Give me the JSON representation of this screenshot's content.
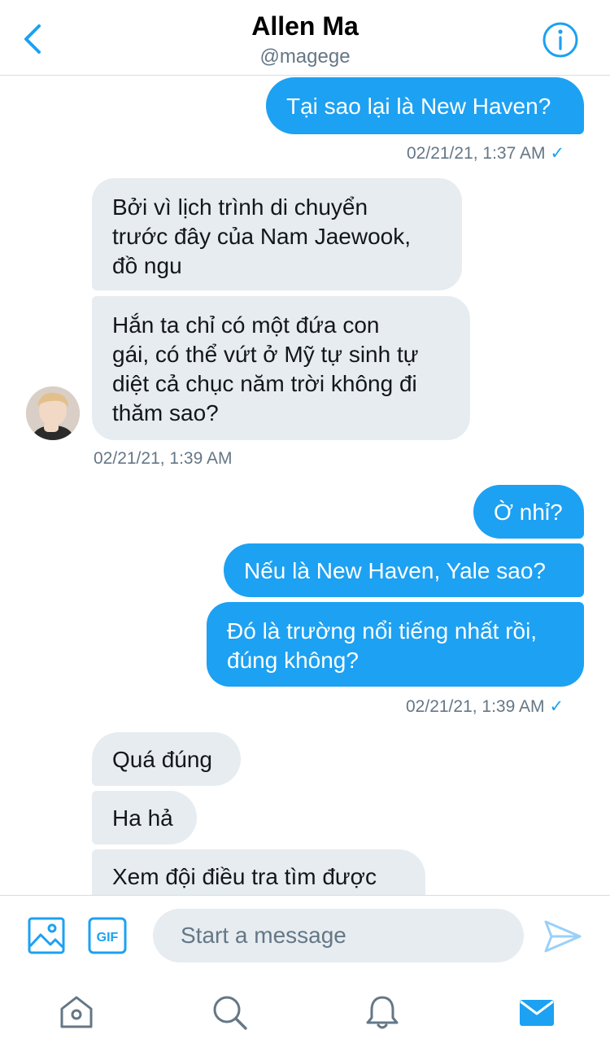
{
  "header": {
    "title": "Allen Ma",
    "handle": "@magege"
  },
  "colors": {
    "accent": "#1da1f2",
    "incoming_bubble": "#e6ecf0",
    "meta_text": "#657786"
  },
  "messages": [
    {
      "direction": "outgoing",
      "text": "Tại sao lại là New Haven?"
    },
    {
      "direction": "incoming",
      "text": "Bởi vì lịch trình di chuyển\ntrước đây của Nam Jaewook,\nđồ ngu"
    },
    {
      "direction": "incoming",
      "text": "Hắn ta chỉ có một đứa con\ngái, có thể vứt ở Mỹ tự sinh tự\ndiệt cả chục năm trời không đi\nthăm sao?"
    },
    {
      "direction": "outgoing",
      "text": "Ờ nhỉ?"
    },
    {
      "direction": "outgoing",
      "text": "Nếu là New Haven, Yale sao?"
    },
    {
      "direction": "outgoing",
      "text": "Đó là trường nổi tiếng nhất rồi,\nđúng không?"
    },
    {
      "direction": "incoming",
      "text": "Quá đúng"
    },
    {
      "direction": "incoming",
      "text": "Ha hả"
    },
    {
      "direction": "incoming",
      "text": "Xem đội điều tra tìm được"
    }
  ],
  "timestamps": [
    {
      "text": "02/21/21, 1:37 AM",
      "check": "✓"
    },
    {
      "text": "02/21/21, 1:39 AM"
    },
    {
      "text": "02/21/21, 1:39 AM",
      "check": "✓"
    }
  ],
  "composer": {
    "placeholder": "Start a message",
    "gif_label": "GIF"
  },
  "icons": {
    "back": "chevron-left-icon",
    "info": "info-icon",
    "media": "image-icon",
    "gif": "gif-icon",
    "send": "send-icon",
    "home": "home-icon",
    "search": "search-icon",
    "notifications": "bell-icon",
    "messages": "mail-icon"
  }
}
